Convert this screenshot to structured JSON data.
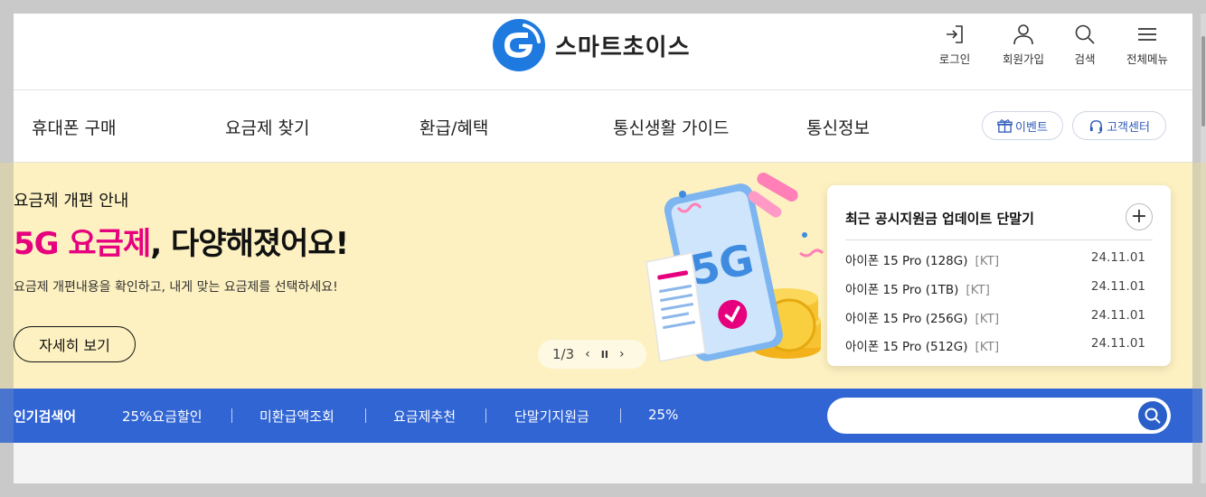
{
  "brand": {
    "name": "스마트초이스"
  },
  "utility": [
    {
      "label": "로그인",
      "icon": "login-icon"
    },
    {
      "label": "회원가입",
      "icon": "user-icon"
    },
    {
      "label": "검색",
      "icon": "search-icon"
    },
    {
      "label": "전체메뉴",
      "icon": "menu-icon"
    }
  ],
  "gnb": {
    "items": [
      "휴대폰 구매",
      "요금제 찾기",
      "환급/혜택",
      "통신생활 가이드",
      "통신정보"
    ],
    "event_label": "이벤트",
    "support_label": "고객센터"
  },
  "hero": {
    "subtitle": "요금제 개편 안내",
    "title_highlight": "5G 요금제",
    "title_rest": ", 다양해졌어요!",
    "description": "요금제 개편내용을 확인하고, 내게 맞는 요금제를 선택하세요!",
    "button_label": "자세히 보기",
    "illustration_text": "5G",
    "slide": {
      "current": "1/3",
      "prev": "‹",
      "pause": "II",
      "next": "›"
    }
  },
  "update_card": {
    "title": "최근 공시지원금 업데이트 단말기",
    "more": "+",
    "rows": [
      {
        "device": "아이폰 15 Pro (128G)",
        "carrier": "[KT]",
        "date": "24.11.01"
      },
      {
        "device": "아이폰 15 Pro (1TB)",
        "carrier": "[KT]",
        "date": "24.11.01"
      },
      {
        "device": "아이폰 15 Pro (256G)",
        "carrier": "[KT]",
        "date": "24.11.01"
      },
      {
        "device": "아이폰 15 Pro (512G)",
        "carrier": "[KT]",
        "date": "24.11.01"
      }
    ]
  },
  "popular": {
    "label": "인기검색어",
    "keywords": [
      "25%요금할인",
      "미환급액조회",
      "요금제추천",
      "단말기지원금",
      "25%"
    ],
    "search_placeholder": ""
  },
  "colors": {
    "brand_blue": "#3165d4",
    "highlight_pink": "#e6007e",
    "hero_bg": "#fdf1c1"
  }
}
